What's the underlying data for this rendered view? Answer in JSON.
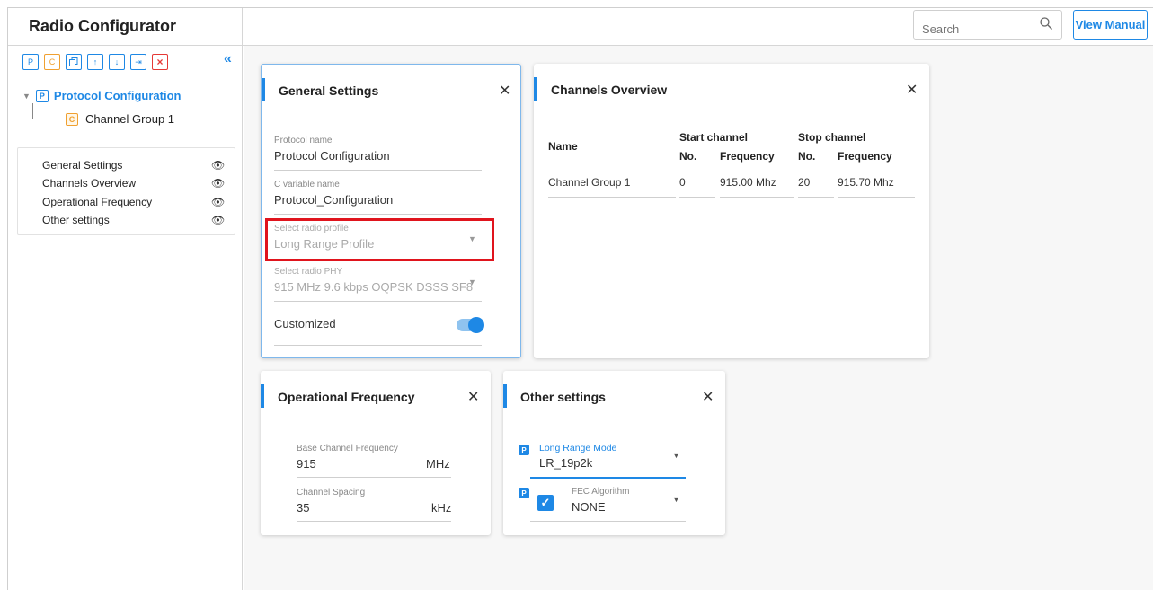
{
  "app": {
    "title": "Radio Configurator"
  },
  "topbar": {
    "search_placeholder": "Search",
    "view_manual": "View Manual"
  },
  "toolbar": {
    "icons": [
      "P",
      "C",
      "",
      "↑",
      "↓",
      "⇥",
      "×"
    ],
    "collapse": "«"
  },
  "tree": {
    "root": {
      "badge": "P",
      "label": "Protocol Configuration"
    },
    "child": {
      "badge": "C",
      "label": "Channel Group 1"
    }
  },
  "visibility": {
    "items": [
      "General Settings",
      "Channels Overview",
      "Operational Frequency",
      "Other settings"
    ],
    "eye": "👁"
  },
  "general": {
    "title": "General Settings",
    "close": "✕",
    "protocol_name_label": "Protocol name",
    "protocol_name_value": "Protocol Configuration",
    "c_var_label": "C variable name",
    "c_var_value": "Protocol_Configuration",
    "profile_label": "Select radio profile",
    "profile_value": "Long Range Profile",
    "phy_label": "Select radio PHY",
    "phy_value": "915 MHz 9.6 kbps OQPSK DSSS SF8",
    "customized_label": "Customized",
    "dropdown_arrow": "▼"
  },
  "channels": {
    "title": "Channels Overview",
    "close": "✕",
    "headers": {
      "name": "Name",
      "start": "Start channel",
      "stop": "Stop channel",
      "no": "No.",
      "frequency": "Frequency"
    },
    "rows": [
      {
        "name": "Channel Group 1",
        "start_no": "0",
        "start_freq": "915.00 Mhz",
        "stop_no": "20",
        "stop_freq": "915.70 Mhz"
      }
    ]
  },
  "operational": {
    "title": "Operational Frequency",
    "close": "✕",
    "base_label": "Base Channel Frequency",
    "base_value": "915",
    "base_unit": "MHz",
    "spacing_label": "Channel Spacing",
    "spacing_value": "35",
    "spacing_unit": "kHz"
  },
  "other": {
    "title": "Other settings",
    "close": "✕",
    "lr_badge": "P",
    "lr_label": "Long Range Mode",
    "lr_value": "LR_19p2k",
    "fec_badge": "P",
    "fec_label": "FEC Algorithm",
    "fec_value": "NONE",
    "check": "✓",
    "dropdown_arrow": "▼"
  },
  "colors": {
    "accent": "#1e88e5",
    "highlight": "#e0141d",
    "orange": "#f0a030"
  }
}
